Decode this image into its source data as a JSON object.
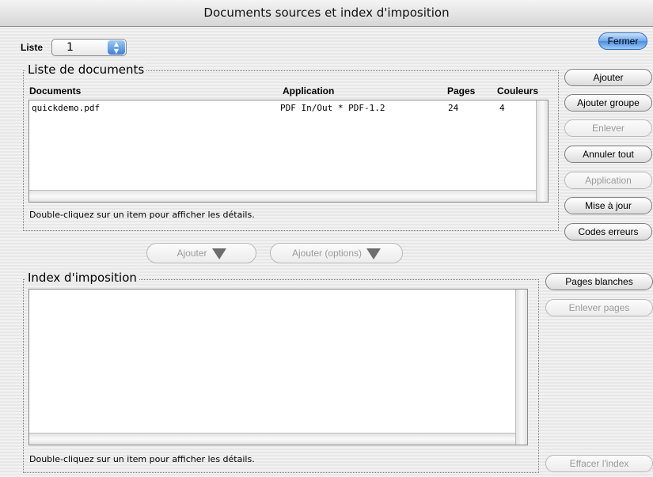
{
  "window": {
    "title": "Documents sources et index d'imposition"
  },
  "liste": {
    "label": "Liste",
    "value": "1"
  },
  "buttons": {
    "fermer": "Fermer",
    "ajouter": "Ajouter",
    "ajouter_groupe": "Ajouter groupe",
    "enlever": "Enlever",
    "annuler_tout": "Annuler tout",
    "application": "Application",
    "mise_a_jour": "Mise à jour",
    "codes_erreurs": "Codes erreurs",
    "ajouter_down": "Ajouter",
    "ajouter_options": "Ajouter (options)",
    "pages_blanches": "Pages blanches",
    "enlever_pages": "Enlever pages",
    "effacer_index": "Effacer l'index"
  },
  "documents": {
    "group_title": "Liste de documents",
    "columns": {
      "documents": "Documents",
      "application": "Application",
      "pages": "Pages",
      "couleurs": "Couleurs"
    },
    "rows": [
      {
        "document": "quickdemo.pdf",
        "application": "PDF In/Out * PDF-1.2",
        "pages": "24",
        "couleurs": "4"
      }
    ],
    "hint": "Double-cliquez sur un item pour afficher les détails."
  },
  "index": {
    "group_title": "Index d'imposition",
    "hint": "Double-cliquez sur un item pour afficher les détails."
  }
}
